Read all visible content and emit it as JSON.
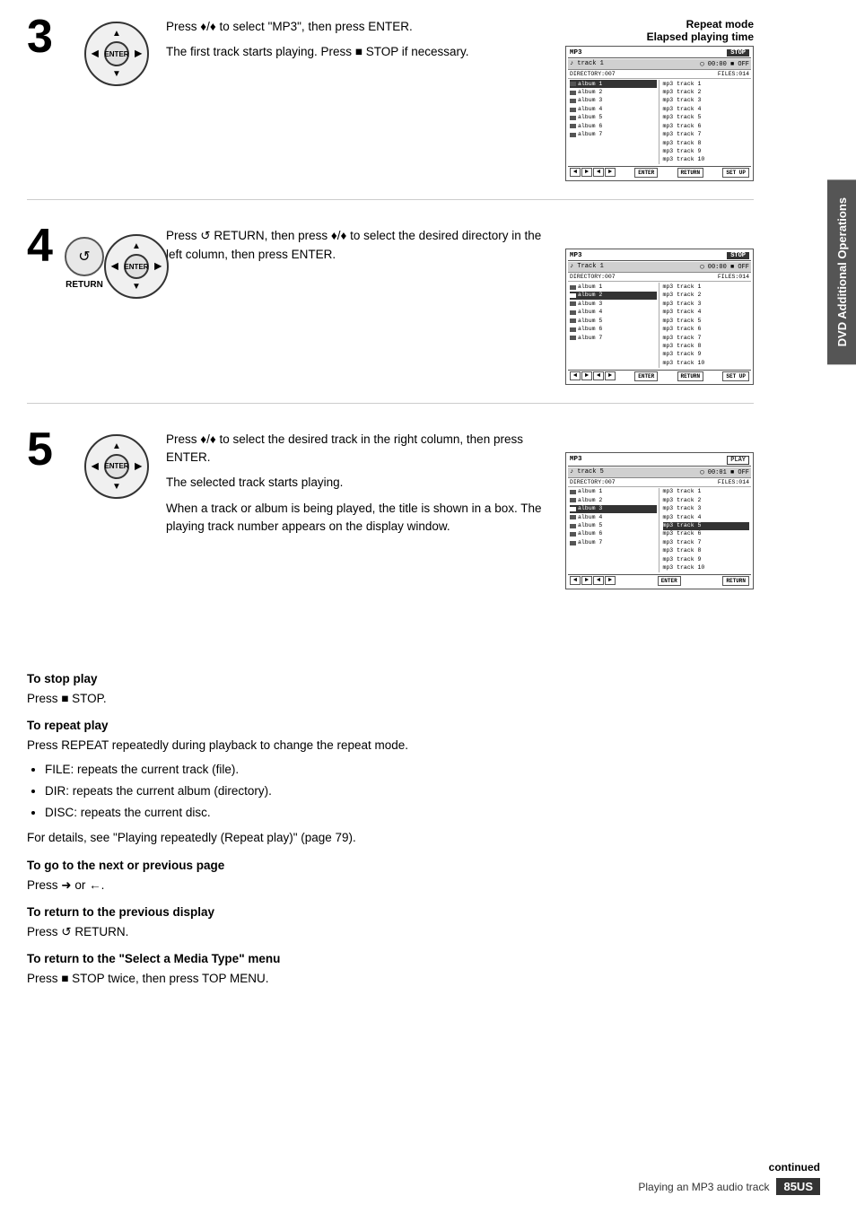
{
  "steps": [
    {
      "number": "3",
      "instruction_lines": [
        "Press ♦/♦ to select \"MP3\", then press ENTER.",
        "The first track starts playing. Press ■ STOP if necessary."
      ],
      "screen": {
        "mode": "MP3",
        "status": "STOP",
        "track": "track 1",
        "time": "00:00",
        "directory": "DIRECTORY:007",
        "files_label": "FILES:014",
        "left_items": [
          "album 1",
          "album 2",
          "album 3",
          "album 4",
          "album 5",
          "album 6",
          "album 7"
        ],
        "right_items": [
          "mp3 track 1",
          "mp3 track 2",
          "mp3 track 3",
          "mp3 track 4",
          "mp3 track 5",
          "mp3 track 6",
          "mp3 track 7",
          "mp3 track 8",
          "mp3 track 9",
          "mp3 track 10"
        ],
        "footer_btns": [
          "ENTER",
          "RETURN",
          "SET UP"
        ],
        "show_setup": true
      },
      "labels": {
        "repeat": "Repeat mode",
        "elapsed": "Elapsed playing time"
      }
    },
    {
      "number": "4",
      "instruction_lines": [
        "Press ↺ RETURN, then press ♦/♦ to select the desired directory in the left column, then press ENTER."
      ],
      "screen": {
        "mode": "MP3",
        "status": "STOP",
        "track": "Track 1",
        "time": "00:00",
        "directory": "DIRECTORY:007",
        "files_label": "FILES:014",
        "left_items": [
          "album 1",
          "album 2",
          "album 3",
          "album 4",
          "album 5",
          "album 6",
          "album 7"
        ],
        "right_items": [
          "mp3 track 1",
          "mp3 track 2",
          "mp3 track 3",
          "mp3 track 4",
          "mp3 track 5",
          "mp3 track 6",
          "mp3 track 7",
          "mp3 track 8",
          "mp3 track 9",
          "mp3 track 10"
        ],
        "footer_btns": [
          "ENTER",
          "RETURN",
          "SET UP"
        ],
        "show_setup": true
      },
      "show_return": true
    },
    {
      "number": "5",
      "instruction_lines": [
        "Press ♦/♦ to select the desired track in the right column, then press ENTER.",
        "The selected track starts playing.",
        "When a track or album is being played, the title is shown in a box. The playing track number appears on the display window."
      ],
      "screen": {
        "mode": "MP3",
        "status": "PLAY",
        "track": "track 5",
        "time": "00:01",
        "directory": "DIRECTORY:007",
        "files_label": "FILES:014",
        "left_items": [
          "album 1",
          "album 2",
          "album 3",
          "album 4",
          "album 5",
          "album 6",
          "album 7"
        ],
        "right_items": [
          "mp3 track 1",
          "mp3 track 2",
          "mp3 track 3",
          "mp3 track 4",
          "mp3 track 5",
          "mp3 track 6",
          "mp3 track 7",
          "mp3 track 8",
          "mp3 track 9",
          "mp3 track 10"
        ],
        "footer_btns": [
          "ENTER",
          "RETURN"
        ],
        "show_setup": false
      }
    }
  ],
  "instructions": {
    "stop_play": {
      "heading": "To stop play",
      "text": "Press ■ STOP."
    },
    "repeat_play": {
      "heading": "To repeat play",
      "text": "Press REPEAT repeatedly during playback to change the repeat mode.",
      "bullets": [
        "FILE: repeats the current track (file).",
        "DIR: repeats the current album (directory).",
        "DISC: repeats the current disc."
      ],
      "note": "For details, see \"Playing repeatedly (Repeat play)\" (page 79)."
    },
    "next_prev": {
      "heading": "To go to the next or previous page",
      "text": "Press ➜ or ←."
    },
    "prev_display": {
      "heading": "To return to the previous display",
      "text": "Press ↺ RETURN."
    },
    "select_menu": {
      "heading": "To return to the \"Select a Media Type\" menu",
      "text": "Press ■ STOP twice, then press TOP MENU."
    }
  },
  "sidebar": {
    "label": "DVD Additional Operations"
  },
  "footer": {
    "continued": "continued",
    "page_label": "Playing an MP3 audio track",
    "page_number": "85US"
  }
}
